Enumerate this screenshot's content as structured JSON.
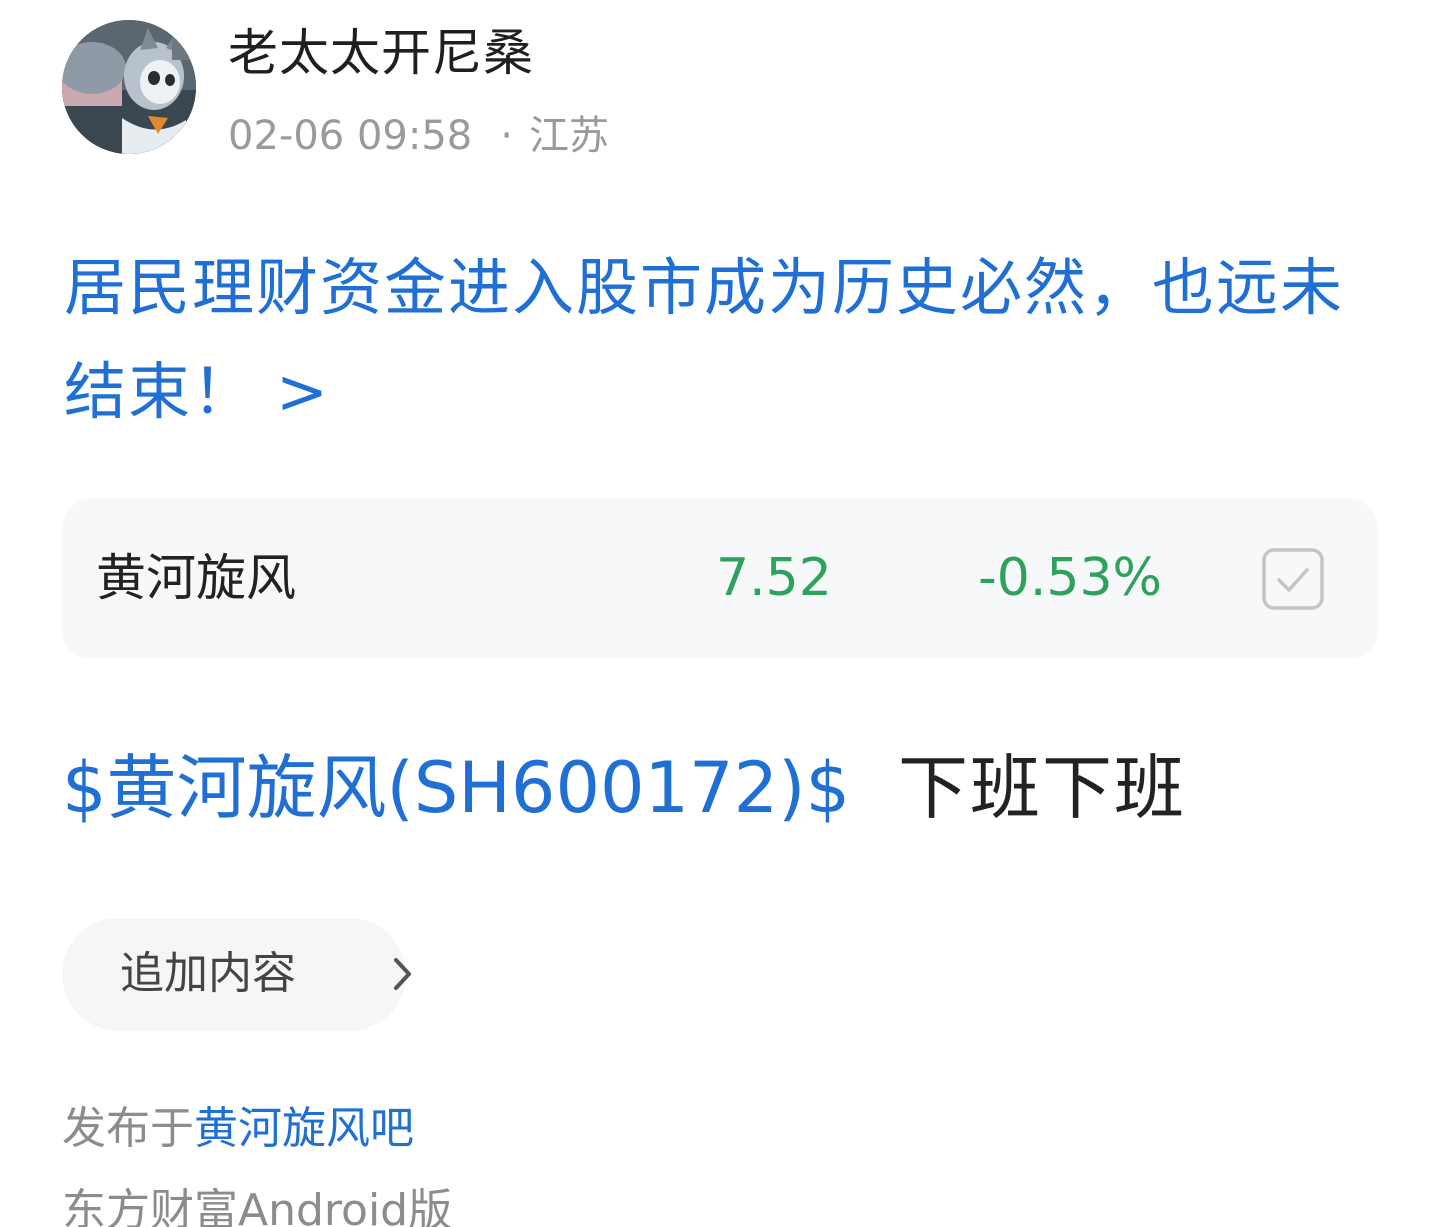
{
  "author": {
    "name": "老太太开尼桑",
    "post_time": "02-06 09:58",
    "meta_separator": "·",
    "location": "江苏",
    "avatar_icon": "cartoon-cat-avatar"
  },
  "post": {
    "title": "居民理财资金进入股市成为历史必然，也远未结束！",
    "title_chevron": ">",
    "stock_tag": "$黄河旋风(SH600172)$",
    "body_text": "下班下班"
  },
  "stock_card": {
    "name": "黄河旋风",
    "price": "7.52",
    "change": "-0.53%",
    "trend_color": "#2da25a",
    "checkbox_icon": "checkbox-checked-icon"
  },
  "actions": {
    "append_label": "追加内容",
    "append_icon": "chevron-right-icon"
  },
  "footer": {
    "published_prefix": "发布于",
    "bar_name": "黄河旋风吧",
    "client": "东方财富Android版"
  },
  "colors": {
    "link_blue": "#1f6fd4",
    "text_dark": "#222222",
    "text_muted": "#9a9a9a",
    "card_bg": "#f7f8fa"
  }
}
